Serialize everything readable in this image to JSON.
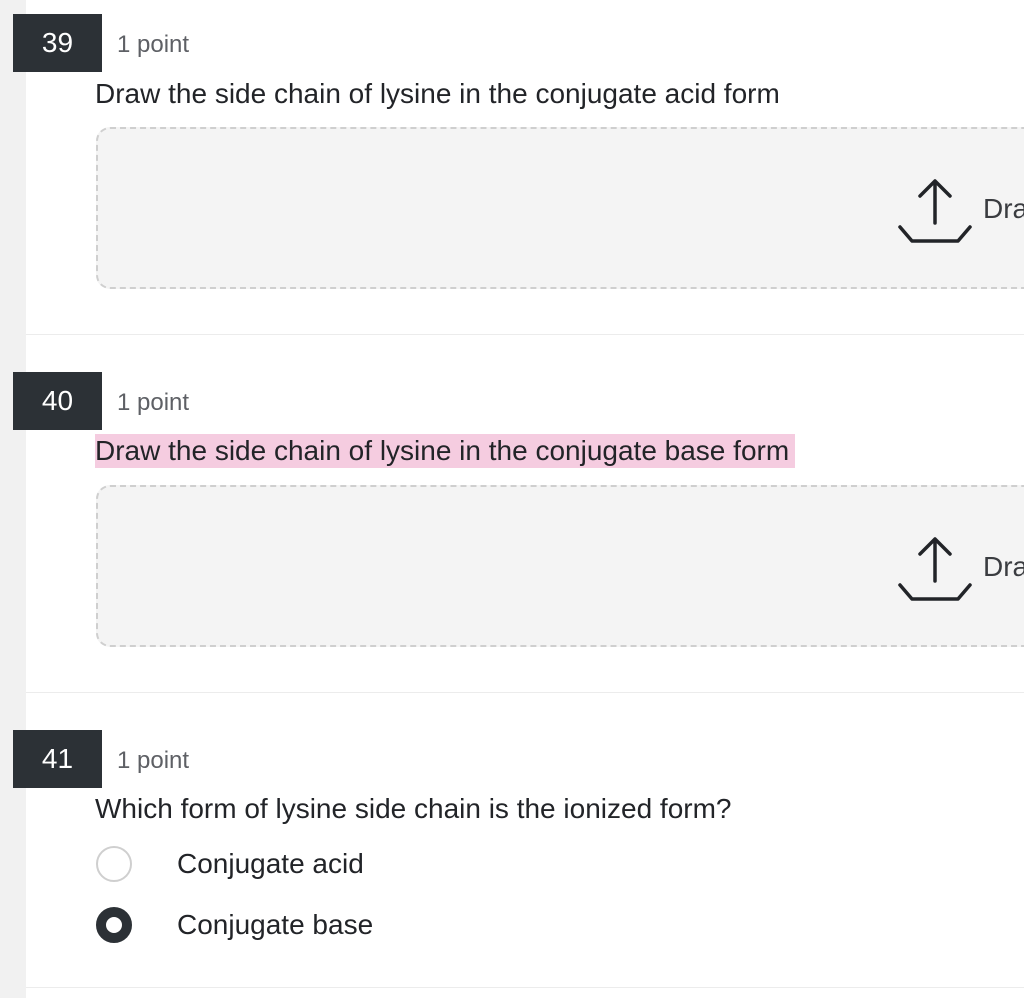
{
  "questions": [
    {
      "number": "39",
      "points": "1 point",
      "prompt": "Draw the side chain of lysine in the conjugate acid form",
      "upload_label": "Dra",
      "upload_icon": "upload-icon"
    },
    {
      "number": "40",
      "points": "1 point",
      "prompt": "Draw the side chain of lysine in the conjugate base form",
      "prompt_highlight_color": "#f5cce0",
      "upload_label": "Dra",
      "upload_icon": "upload-icon"
    },
    {
      "number": "41",
      "points": "1 point",
      "prompt": "Which form of lysine side chain is the ionized form?",
      "options": [
        {
          "label": "Conjugate acid",
          "selected": false
        },
        {
          "label": "Conjugate base",
          "selected": true
        }
      ]
    }
  ],
  "colors": {
    "number_badge_bg": "#2c3136",
    "points_text": "#5e6065",
    "dropzone_bg": "#f4f4f4",
    "dropzone_border": "#cfcfcf"
  }
}
